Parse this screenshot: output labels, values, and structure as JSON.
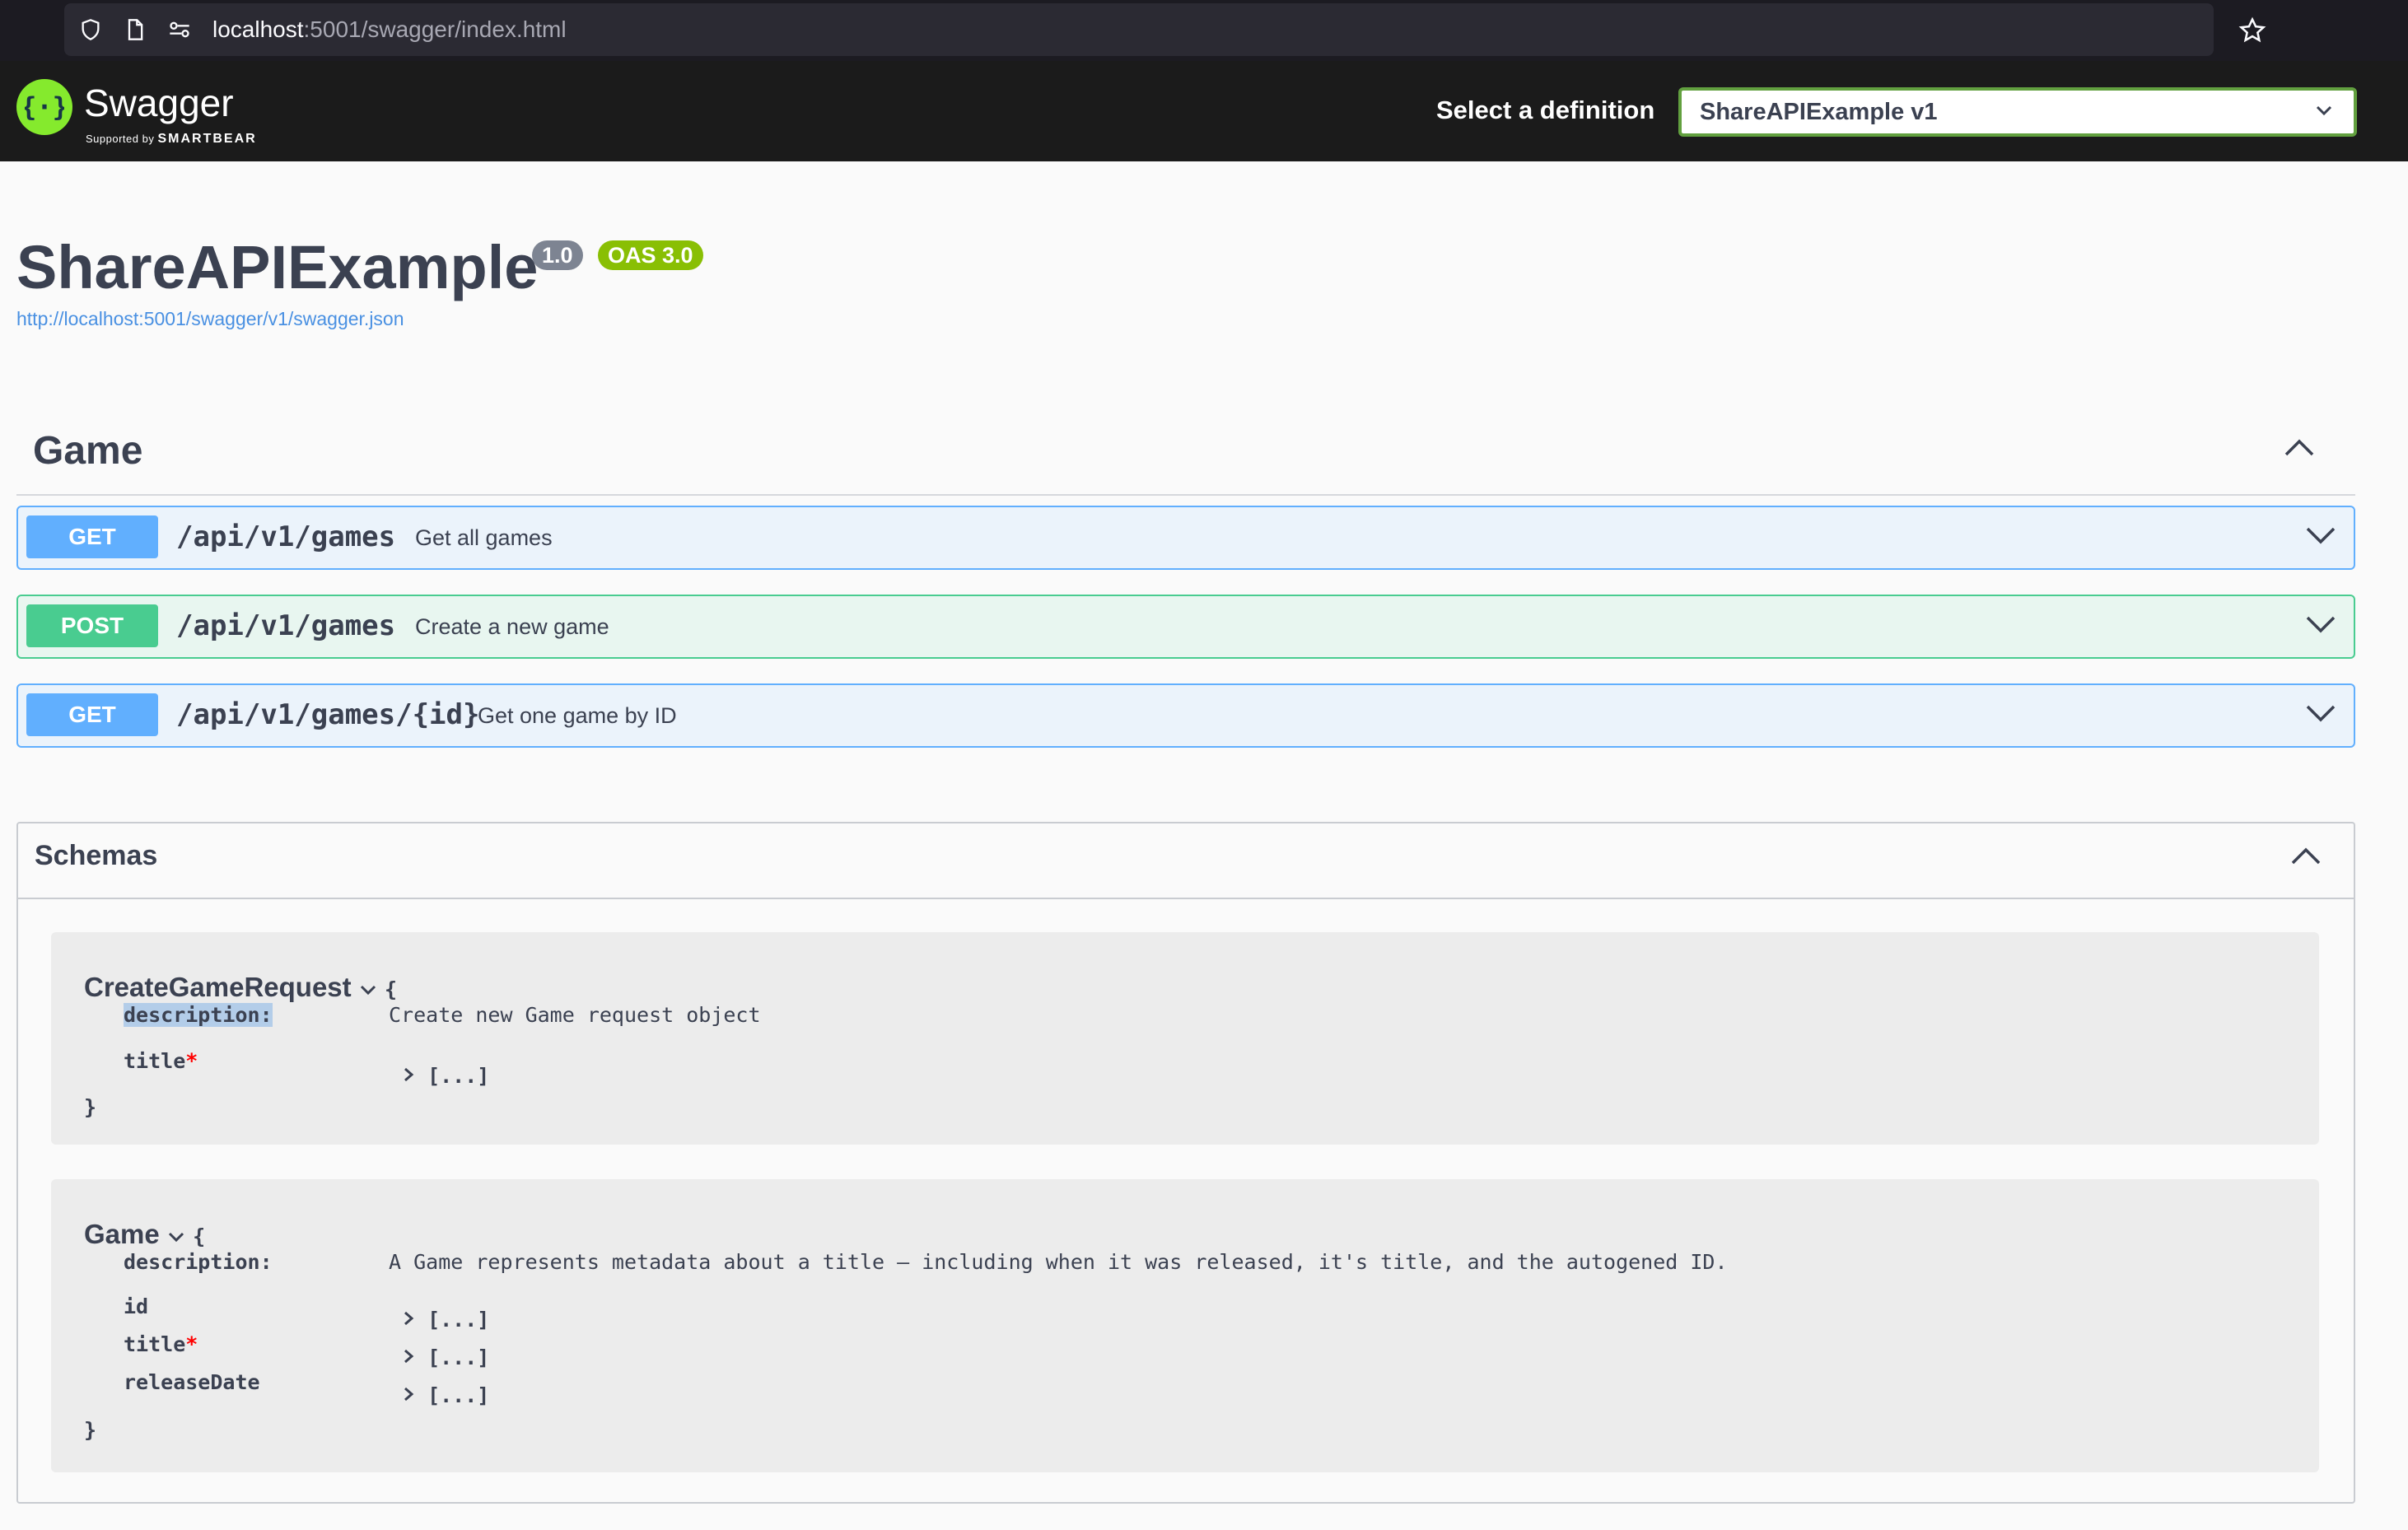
{
  "browser": {
    "url_host": "localhost",
    "url_rest": ":5001/swagger/index.html"
  },
  "topbar": {
    "logo_name": "Swagger",
    "logo_sub_prefix": "Supported by",
    "logo_sub_brand": "SMARTBEAR",
    "select_label": "Select a definition",
    "select_value": "ShareAPIExample v1"
  },
  "info": {
    "title": "ShareAPIExample",
    "version": "1.0",
    "oas": "OAS 3.0",
    "link": "http://localhost:5001/swagger/v1/swagger.json"
  },
  "tag": {
    "name": "Game",
    "operations": [
      {
        "method": "GET",
        "path": "/api/v1/games",
        "summary": "Get all games"
      },
      {
        "method": "POST",
        "path": "/api/v1/games",
        "summary": "Create a new game"
      },
      {
        "method": "GET",
        "path": "/api/v1/games/{id}",
        "summary": "Get one game by ID"
      }
    ]
  },
  "schemas": {
    "title": "Schemas",
    "models": [
      {
        "name": "CreateGameRequest",
        "open_brace": "{",
        "close_brace": "}",
        "description_key": "description:",
        "description": "Create new Game request object",
        "properties": [
          {
            "key": "title",
            "required": "*",
            "value": "[...]"
          }
        ]
      },
      {
        "name": "Game",
        "open_brace": "{",
        "close_brace": "}",
        "description_key": "description:",
        "description": "A Game represents metadata about a title – including when it was released, it's title, and the autogened ID.",
        "properties": [
          {
            "key": "id",
            "required": "",
            "value": "[...]"
          },
          {
            "key": "title",
            "required": "*",
            "value": "[...]"
          },
          {
            "key": "releaseDate",
            "required": "",
            "value": "[...]"
          }
        ]
      }
    ]
  },
  "colors": {
    "get": "#61affe",
    "post": "#49cc90",
    "swagger_green": "#85ea2d",
    "badge_version": "#7d8492",
    "badge_oas": "#89bf04"
  }
}
